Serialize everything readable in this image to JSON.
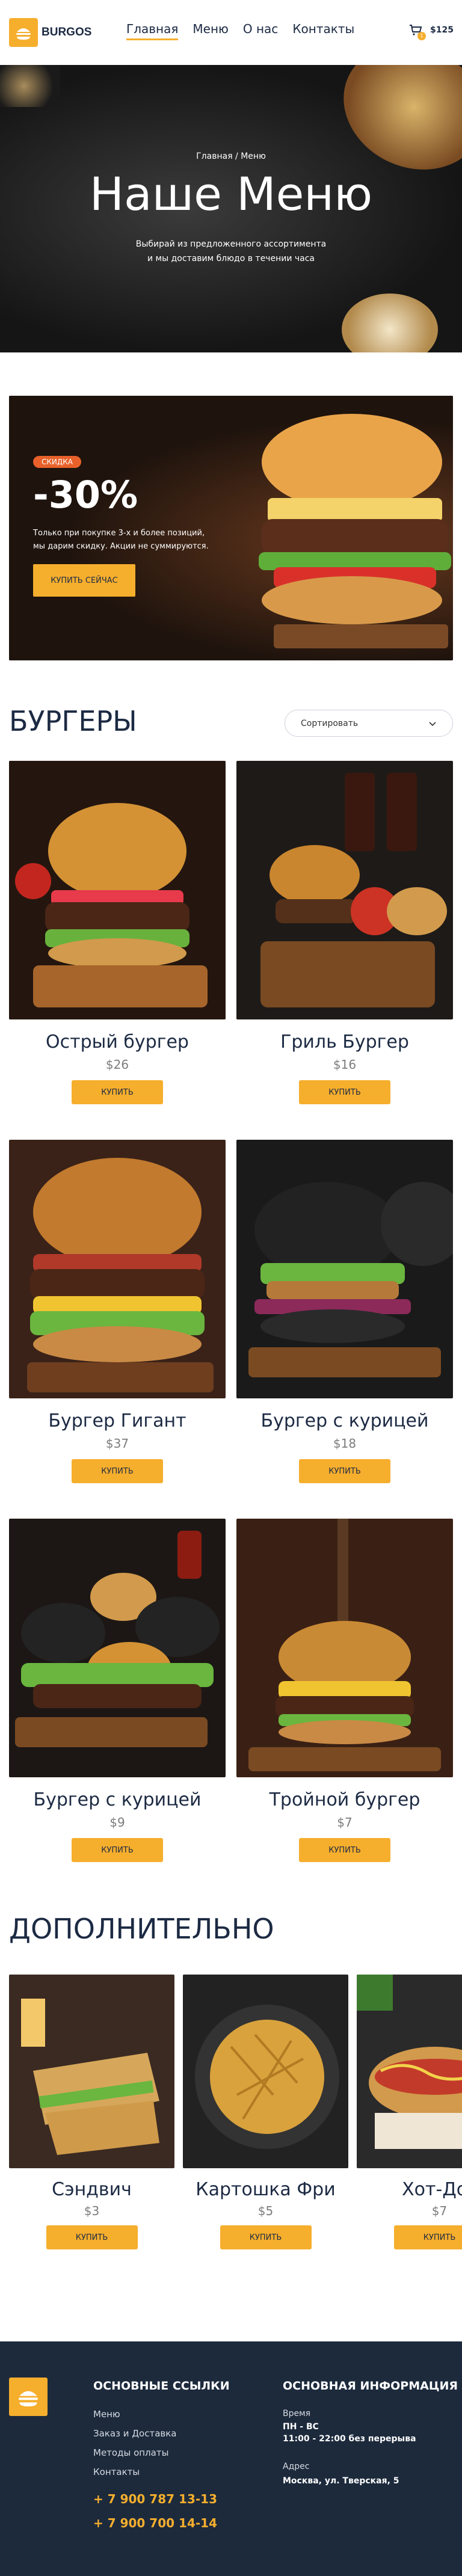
{
  "header": {
    "brand": "BURGOS",
    "nav": [
      "Главная",
      "Меню",
      "О нас",
      "Контакты"
    ],
    "cart_count": "1",
    "cart_total": "$125"
  },
  "hero": {
    "breadcrumb": "Главная / Меню",
    "title": "Наше Меню",
    "subtitle_line1": "Выбирай из предложенного ассортимента",
    "subtitle_line2": "и мы доставим блюдо в течении часа"
  },
  "promo": {
    "badge": "СКИДКА",
    "discount": "-30%",
    "text_line1": "Только при покупке 3-х и более позиций,",
    "text_line2": "мы дарим скидку. Акции не суммируются.",
    "button": "КУПИТЬ СЕЙЧАС"
  },
  "burgers": {
    "title": "БУРГЕРЫ",
    "sort_label": "Сортировать",
    "items": [
      {
        "name": "Острый бургер",
        "price": "$26",
        "buy": "КУПИТЬ"
      },
      {
        "name": "Гриль Бургер",
        "price": "$16",
        "buy": "КУПИТЬ"
      },
      {
        "name": "Бургер Гигант",
        "price": "$37",
        "buy": "КУПИТЬ"
      },
      {
        "name": "Бургер с курицей",
        "price": "$18",
        "buy": "КУПИТЬ"
      },
      {
        "name": "Бургер с курицей",
        "price": "$9",
        "buy": "КУПИТЬ"
      },
      {
        "name": "Тройной бургер",
        "price": "$7",
        "buy": "КУПИТЬ"
      }
    ]
  },
  "extras": {
    "title": "ДОПОЛНИТЕЛЬНО",
    "items": [
      {
        "name": "Сэндвич",
        "price": "$3",
        "buy": "КУПИТЬ"
      },
      {
        "name": "Картошка Фри",
        "price": "$5",
        "buy": "КУПИТЬ"
      },
      {
        "name": "Хот-Дог",
        "price": "$7",
        "buy": "КУПИТЬ"
      }
    ]
  },
  "footer": {
    "links_title": "ОСНОВНЫЕ ССЫЛКИ",
    "links": [
      "Меню",
      "Заказ и Доставка",
      "Методы оплаты",
      "Контакты"
    ],
    "phones": [
      "+ 7 900 787 13-13",
      "+ 7 900 700 14-14"
    ],
    "info_title": "ОСНОВНАЯ ИНФОРМАЦИЯ",
    "time_label": "Время",
    "time_days": "ПН - ВС",
    "time_hours": "11:00 - 22:00 без перерыва",
    "address_label": "Адрес",
    "address_value": "Москва, ул. Тверская, 5"
  },
  "colors": {
    "accent": "#f6ae2d",
    "navy": "#1c2a43",
    "footer_bg": "#1c2a3c",
    "badge": "#e8612a"
  }
}
